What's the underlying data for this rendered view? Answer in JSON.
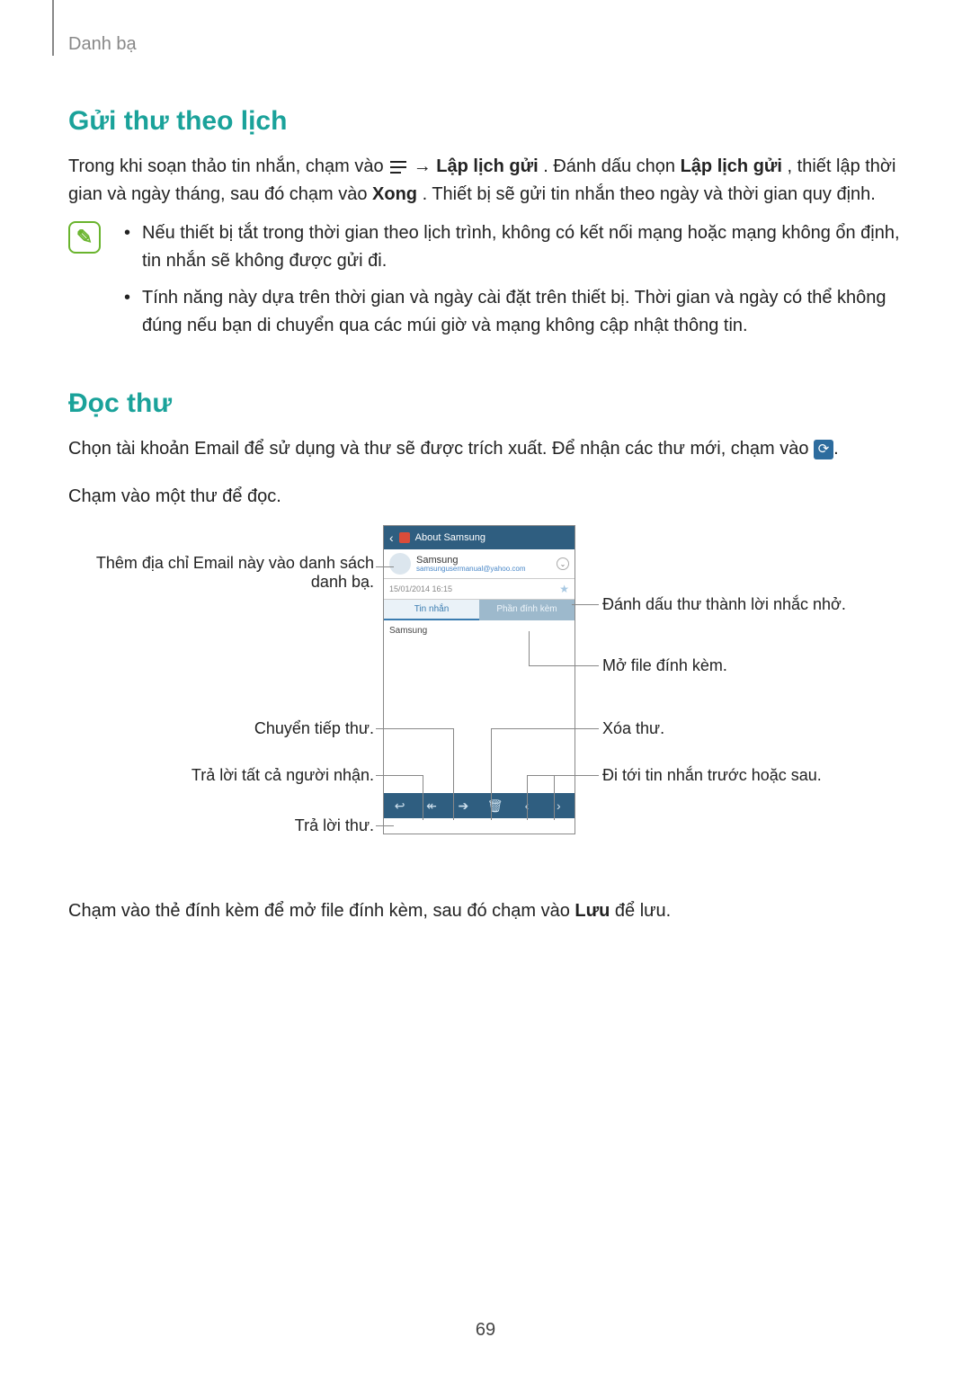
{
  "section_label": "Danh bạ",
  "h1": "Gửi thư theo lịch",
  "p1_a": "Trong khi soạn thảo tin nhắn, chạm vào ",
  "p1_b": " → ",
  "p1_bold1": "Lập lịch gửi",
  "p1_c": ". Đánh dấu chọn ",
  "p1_bold2": "Lập lịch gửi",
  "p1_d": ", thiết lập thời gian và ngày tháng, sau đó chạm vào ",
  "p1_bold3": "Xong",
  "p1_e": ". Thiết bị sẽ gửi tin nhắn theo ngày và thời gian quy định.",
  "note1": "Nếu thiết bị tắt trong thời gian theo lịch trình, không có kết nối mạng hoặc mạng không ổn định, tin nhắn sẽ không được gửi đi.",
  "note2": "Tính năng này dựa trên thời gian và ngày cài đặt trên thiết bị. Thời gian và ngày có thể không đúng nếu bạn di chuyển qua các múi giờ và mạng không cập nhật thông tin.",
  "h2": "Đọc thư",
  "p2_a": "Chọn tài khoản Email để sử dụng và thư sẽ được trích xuất. Để nhận các thư mới, chạm vào ",
  "p2_b": ".",
  "p3": "Chạm vào một thư để đọc.",
  "p4_a": "Chạm vào thẻ đính kèm để mở file đính kèm, sau đó chạm vào ",
  "p4_bold": "Lưu",
  "p4_b": " để lưu.",
  "phone": {
    "title": "About Samsung",
    "sender_name": "Samsung",
    "sender_email": "samsungusermanual@yahoo.com",
    "datetime": "15/01/2014 16:15",
    "tab_msg": "Tin nhắn",
    "tab_attach": "Phần đính kèm",
    "body_text": "Samsung"
  },
  "callouts": {
    "left1": "Thêm địa chỉ Email này vào danh sách danh bạ.",
    "left2": "Chuyển tiếp thư.",
    "left3": "Trả lời tất cả người nhận.",
    "left4": "Trả lời thư.",
    "right1": "Đánh dấu thư thành lời nhắc nhở.",
    "right2": "Mở file đính kèm.",
    "right3": "Xóa thư.",
    "right4": "Đi tới tin nhắn trước hoặc sau."
  },
  "pagenum": "69"
}
